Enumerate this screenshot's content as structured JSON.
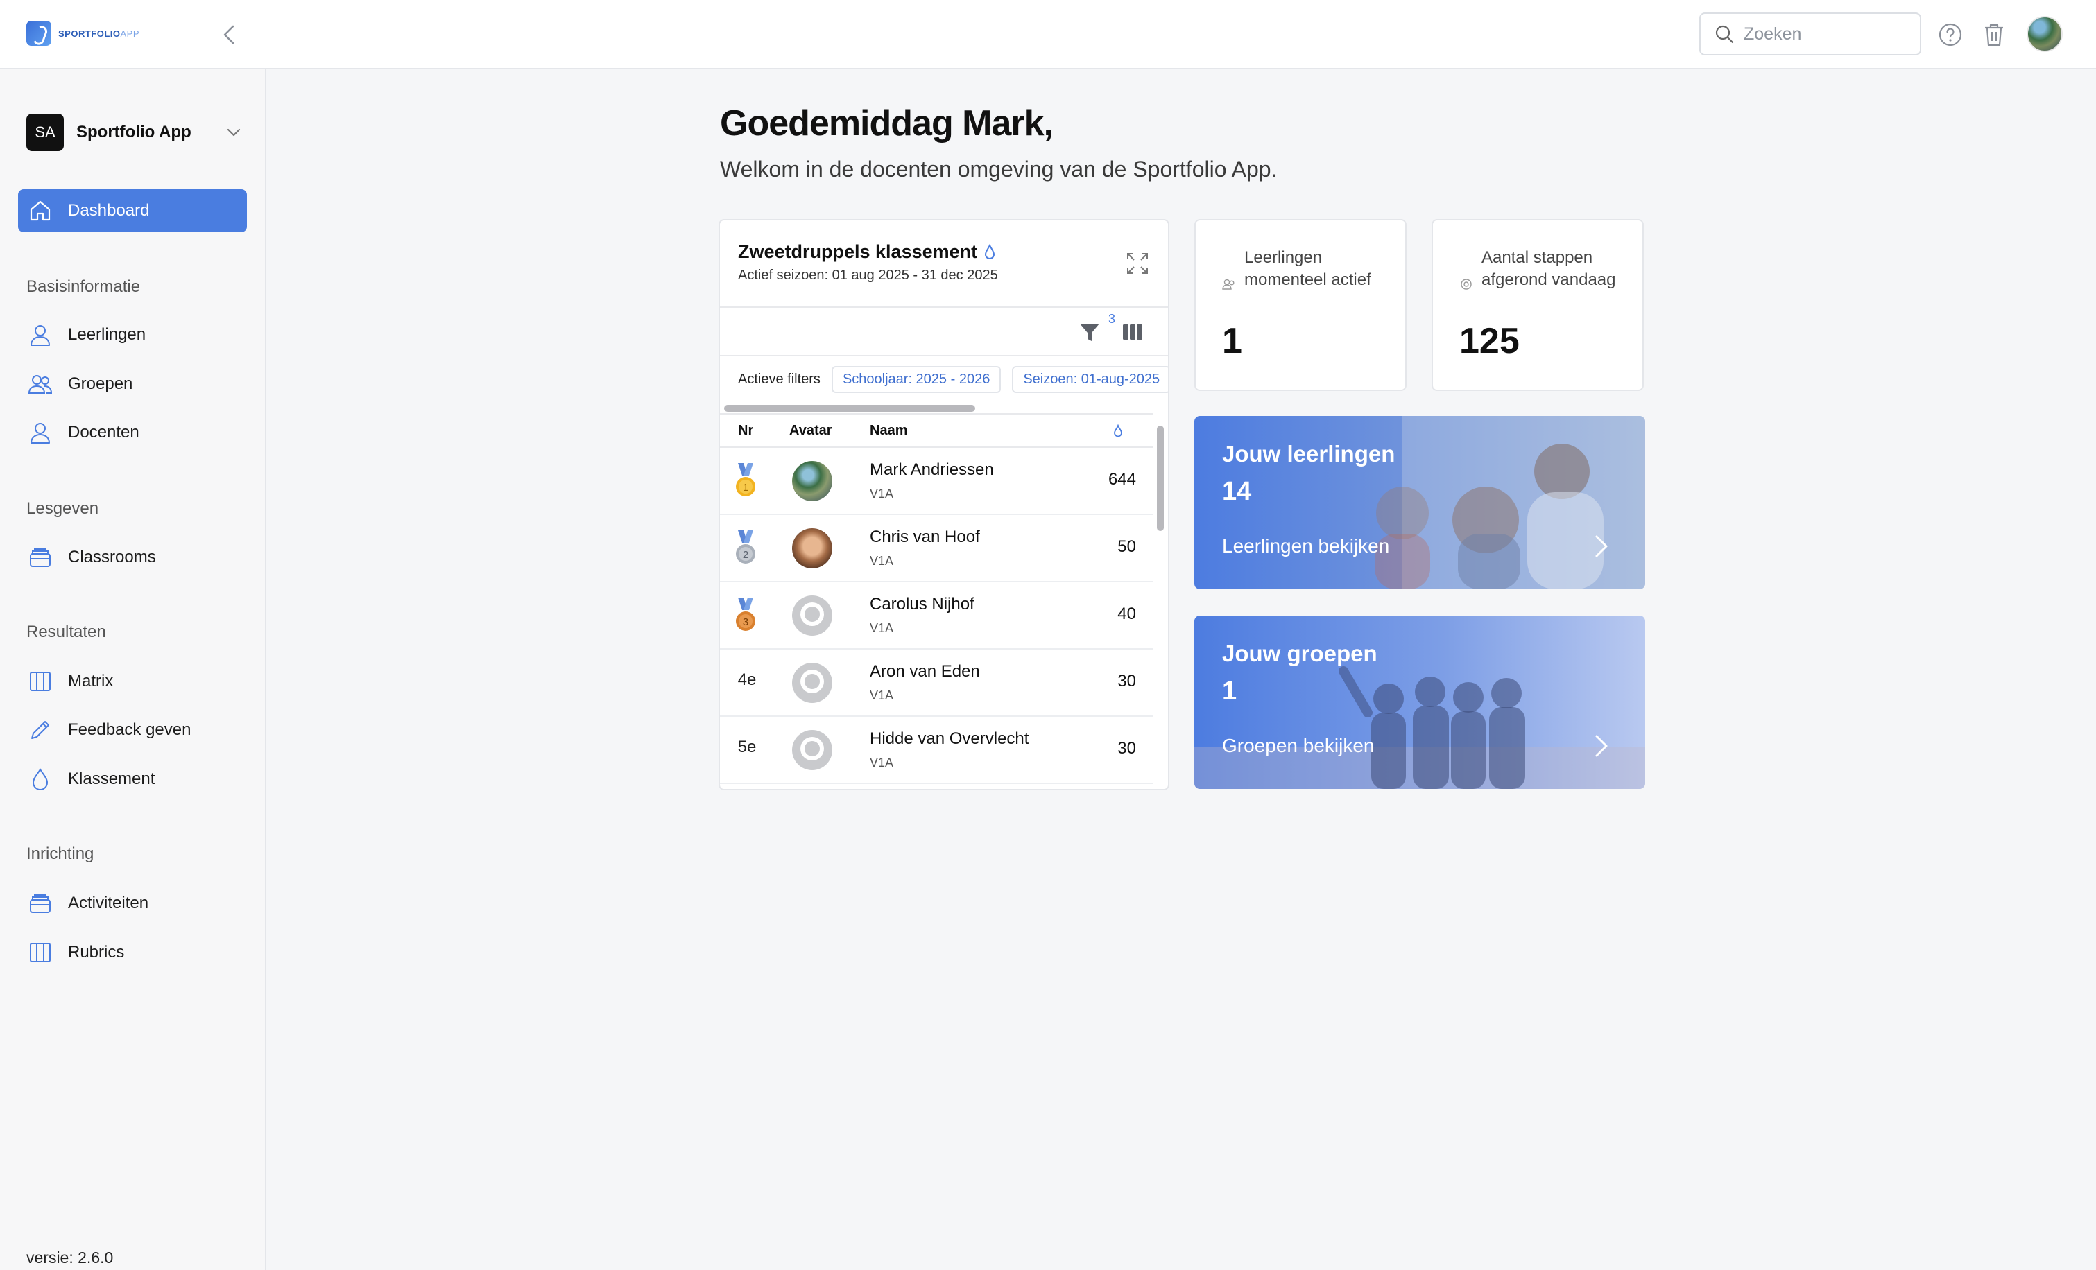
{
  "app": {
    "logo_text": "SPORTFOLIO",
    "logo_suffix": "APP",
    "version": "versie: 2.6.0"
  },
  "topbar": {
    "search_placeholder": "Zoeken"
  },
  "sidebar": {
    "org_badge": "SA",
    "org_name": "Sportfolio App",
    "dashboard": "Dashboard",
    "sections": {
      "basis": "Basisinformatie",
      "lesgeven": "Lesgeven",
      "resultaten": "Resultaten",
      "inrichting": "Inrichting"
    },
    "items": {
      "leerlingen": "Leerlingen",
      "groepen": "Groepen",
      "docenten": "Docenten",
      "classrooms": "Classrooms",
      "matrix": "Matrix",
      "feedback": "Feedback geven",
      "klassement": "Klassement",
      "activiteiten": "Activiteiten",
      "rubrics": "Rubrics"
    }
  },
  "main": {
    "greeting": "Goedemiddag Mark,",
    "subtitle": "Welkom in de docenten omgeving van de Sportfolio App."
  },
  "leaderboard": {
    "title": "Zweetdruppels klassement",
    "season": "Actief seizoen: 01 aug 2025 - 31 dec 2025",
    "filter_count": "3",
    "active_filters_label": "Actieve filters",
    "chips": [
      "Schooljaar: 2025 - 2026",
      "Seizoen: 01-aug-2025"
    ],
    "columns": {
      "nr": "Nr",
      "avatar": "Avatar",
      "naam": "Naam"
    },
    "rows": [
      {
        "rank": "1",
        "name": "Mark Andriessen",
        "class": "V1A",
        "points": "644"
      },
      {
        "rank": "2",
        "name": "Chris van Hoof",
        "class": "V1A",
        "points": "50"
      },
      {
        "rank": "3",
        "name": "Carolus Nijhof",
        "class": "V1A",
        "points": "40"
      },
      {
        "rank": "4e",
        "name": "Aron van Eden",
        "class": "V1A",
        "points": "30"
      },
      {
        "rank": "5e",
        "name": "Hidde van Overvlecht",
        "class": "V1A",
        "points": "30"
      }
    ]
  },
  "stats": {
    "active": {
      "label": "Leerlingen momenteel actief",
      "value": "1"
    },
    "steps": {
      "label": "Aantal stappen afgerond vandaag",
      "value": "125"
    }
  },
  "heroes": {
    "students": {
      "title": "Jouw leerlingen",
      "count": "14",
      "link": "Leerlingen bekijken"
    },
    "groups": {
      "title": "Jouw groepen",
      "count": "1",
      "link": "Groepen bekijken"
    }
  },
  "colors": {
    "accent": "#4a7de0",
    "gold": "#f2b320",
    "silver": "#a9b0ba",
    "bronze": "#d9802e"
  }
}
